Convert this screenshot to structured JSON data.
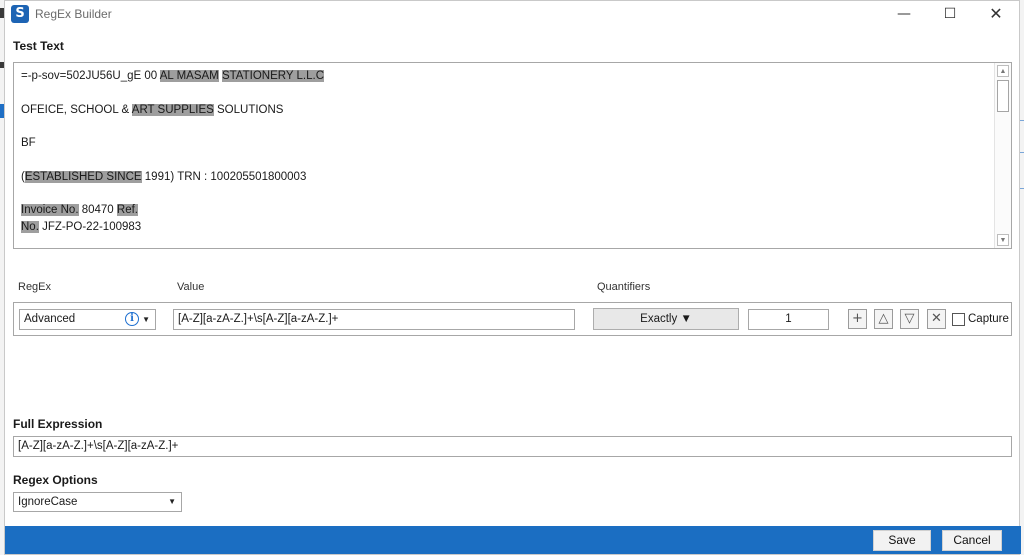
{
  "window": {
    "title": "RegEx Builder",
    "icon_glyph": "S",
    "icons": [
      "app-logo-icon",
      "minimize-icon",
      "maximize-icon",
      "close-icon"
    ],
    "controls": {
      "minimize": "—",
      "maximize": "☐",
      "close": "✕"
    }
  },
  "test_text": {
    "label": "Test Text",
    "lines": {
      "l1_a": "=-p-sov=502JU56U_gE 00 ",
      "l1_h1": "AL MASAM",
      "l1_b": " ",
      "l1_h2": "STATIONERY L.L.C",
      "l2_a": "OFEICE, SCHOOL & ",
      "l2_h1": "ART SUPPLIES",
      "l2_b": " SOLUTIONS",
      "l3": "BF",
      "l4_a": "(",
      "l4_h1": "ESTABLISHED SINCE",
      "l4_b": " 1991) TRN : 100205501800003",
      "l5_h1": "Invoice No.",
      "l5_b": " 80470 ",
      "l5_h2": "Ref.",
      "l6_h1": "No.",
      "l6_b": " JFZ-PO-22-100983"
    },
    "highlight_color": "#9e9e9e"
  },
  "rule": {
    "headers": {
      "regex": "RegEx",
      "value": "Value",
      "quantifiers": "Quantifiers"
    },
    "type_selected": "Advanced",
    "value": "[A-Z][a-zA-Z.]+\\s[A-Z][a-zA-Z.]+",
    "quantifier_selected": "Exactly",
    "count": "1",
    "buttons": {
      "add": "+",
      "up": "△",
      "down": "▽",
      "remove": "✕"
    },
    "capture_label": "Capture",
    "capture_checked": false
  },
  "full_expression": {
    "label": "Full Expression",
    "value": "[A-Z][a-zA-Z.]+\\s[A-Z][a-zA-Z.]+"
  },
  "regex_options": {
    "label": "Regex Options",
    "selected": "IgnoreCase"
  },
  "footer": {
    "save_label": "Save",
    "cancel_label": "Cancel"
  },
  "colors": {
    "accent": "#1b6ec2",
    "info": "#1d6fd0"
  }
}
